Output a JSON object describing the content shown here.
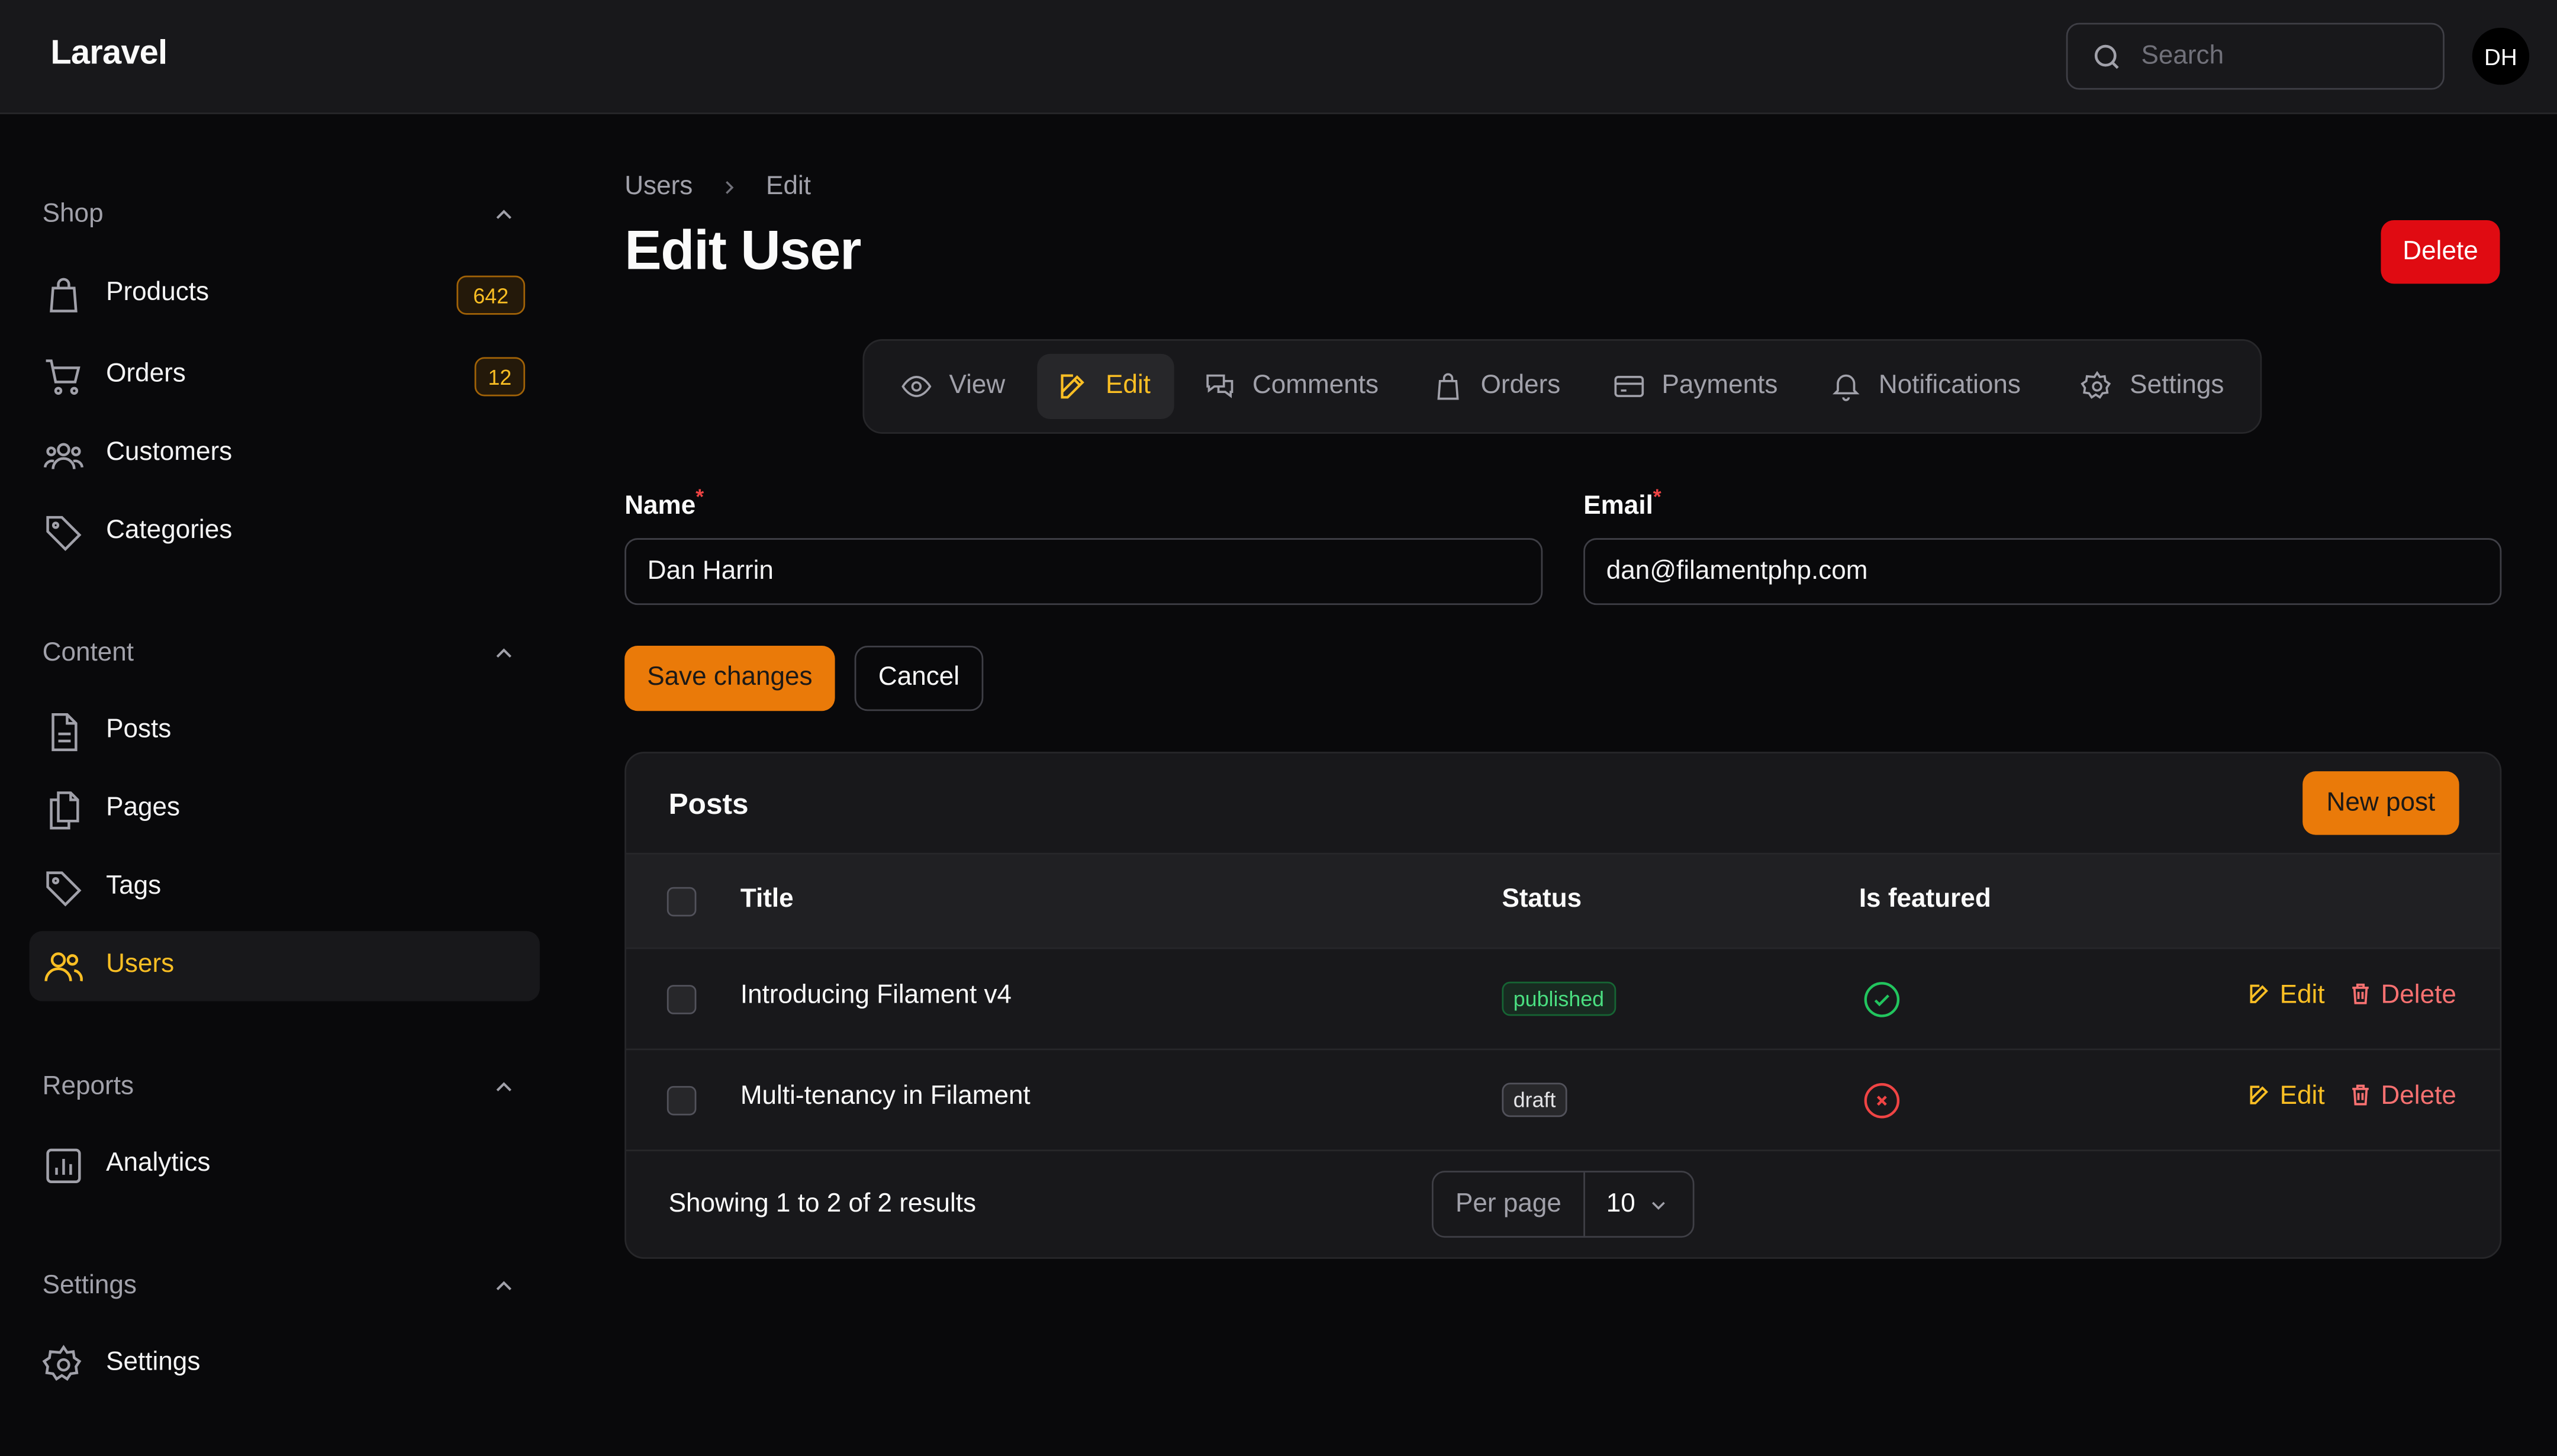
{
  "app": {
    "brand": "Laravel",
    "search_placeholder": "Search",
    "avatar_initials": "DH"
  },
  "sidebar": {
    "groups": [
      {
        "label": "Shop",
        "items": [
          {
            "label": "Products",
            "icon": "shopping-bag-icon",
            "badge": "642"
          },
          {
            "label": "Orders",
            "icon": "shopping-cart-icon",
            "badge": "12"
          },
          {
            "label": "Customers",
            "icon": "user-group-icon"
          },
          {
            "label": "Categories",
            "icon": "tag-icon"
          }
        ]
      },
      {
        "label": "Content",
        "items": [
          {
            "label": "Posts",
            "icon": "document-icon"
          },
          {
            "label": "Pages",
            "icon": "documents-icon"
          },
          {
            "label": "Tags",
            "icon": "tag-icon"
          },
          {
            "label": "Users",
            "icon": "users-icon",
            "active": true
          }
        ]
      },
      {
        "label": "Reports",
        "items": [
          {
            "label": "Analytics",
            "icon": "chart-bar-icon"
          }
        ]
      },
      {
        "label": "Settings",
        "items": [
          {
            "label": "Settings",
            "icon": "cog-icon"
          }
        ]
      }
    ]
  },
  "header": {
    "breadcrumb": [
      "Users",
      "Edit"
    ],
    "title": "Edit User",
    "delete_label": "Delete"
  },
  "tabs": [
    {
      "label": "View",
      "icon": "eye-icon"
    },
    {
      "label": "Edit",
      "icon": "pencil-square-icon",
      "active": true
    },
    {
      "label": "Comments",
      "icon": "chat-bubbles-icon"
    },
    {
      "label": "Orders",
      "icon": "shopping-bag-icon"
    },
    {
      "label": "Payments",
      "icon": "credit-card-icon"
    },
    {
      "label": "Notifications",
      "icon": "bell-icon"
    },
    {
      "label": "Settings",
      "icon": "cog-icon"
    }
  ],
  "form": {
    "name": {
      "label": "Name",
      "required_mark": "*",
      "value": "Dan Harrin"
    },
    "email": {
      "label": "Email",
      "required_mark": "*",
      "value": "dan@filamentphp.com"
    },
    "save_label": "Save changes",
    "cancel_label": "Cancel"
  },
  "posts": {
    "title": "Posts",
    "new_label": "New post",
    "columns": [
      "Title",
      "Status",
      "Is featured"
    ],
    "rows": [
      {
        "title": "Introducing Filament v4",
        "status": "published",
        "featured": true,
        "edit": "Edit",
        "delete": "Delete"
      },
      {
        "title": "Multi-tenancy in Filament",
        "status": "draft",
        "featured": false,
        "edit": "Edit",
        "delete": "Delete"
      }
    ],
    "summary": "Showing 1 to 2 of 2 results",
    "per_page_label": "Per page",
    "per_page_value": "10"
  },
  "colors": {
    "accent": "#ea7a09",
    "active_text": "#fbbf24",
    "danger": "#e00b12",
    "success": "#22c55e",
    "error": "#ef4444"
  }
}
